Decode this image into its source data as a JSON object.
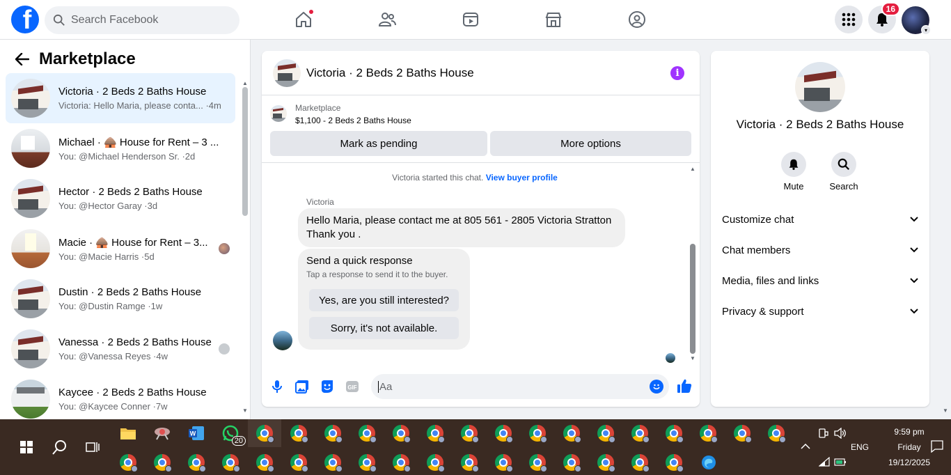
{
  "topbar": {
    "logo_letter": "f",
    "search_placeholder": "Search Facebook",
    "notifications_count": "16",
    "nav_icons": [
      "home-icon",
      "friends-icon",
      "video-icon",
      "marketplace-icon",
      "groups-icon"
    ],
    "brand_color": "#0866ff"
  },
  "sidebar": {
    "title": "Marketplace",
    "conversations": [
      {
        "name": "Victoria · 2 Beds 2 Baths House",
        "sub": "Victoria: Hello Maria, please conta... ·4m",
        "active": true
      },
      {
        "name": "Michael · 🛖 House for Rent – 3 ...",
        "sub": "You: @Michael Henderson Sr. ·2d"
      },
      {
        "name": "Hector · 2 Beds 2 Baths House",
        "sub": "You: @Hector Garay ·3d"
      },
      {
        "name": "Macie · 🛖 House for Rent – 3...",
        "sub": "You: @Macie Harris ·5d"
      },
      {
        "name": "Dustin · 2 Beds 2 Baths House",
        "sub": "You: @Dustin Ramge ·1w"
      },
      {
        "name": "Vanessa · 2 Beds 2 Baths House",
        "sub": "You: @Vanessa Reyes ·4w"
      },
      {
        "name": "Kaycee · 2 Beds 2 Baths House",
        "sub": "You: @Kaycee Conner ·7w"
      }
    ]
  },
  "chat": {
    "title": "Victoria · 2 Beds 2 Baths House",
    "listing_source": "Marketplace",
    "listing_price_title": "$1,100 - 2 Beds 2 Baths House",
    "mark_pending_label": "Mark as pending",
    "more_options_label": "More options",
    "started_text": "Victoria started this chat.",
    "view_buyer_profile": "View buyer profile",
    "sender": "Victoria",
    "message_line1": "Hello Maria, please contact me at 805 561 - 2805 Victoria Stratton",
    "message_line2": "Thank you .",
    "quick_title": "Send a quick response",
    "quick_sub": "Tap a response to send it to the buyer.",
    "quick_reply_1": "Yes, are you still interested?",
    "quick_reply_2": "Sorry, it's not available.",
    "composer_placeholder": "Aa"
  },
  "info_panel": {
    "title": "Victoria · 2 Beds 2 Baths House",
    "mute_label": "Mute",
    "search_label": "Search",
    "sections": [
      "Customize chat",
      "Chat members",
      "Media, files and links",
      "Privacy & support"
    ]
  },
  "taskbar": {
    "whatsapp_badge": "20",
    "language": "ENG",
    "time": "9:59 pm",
    "day": "Friday",
    "date": "19/12/2025"
  }
}
